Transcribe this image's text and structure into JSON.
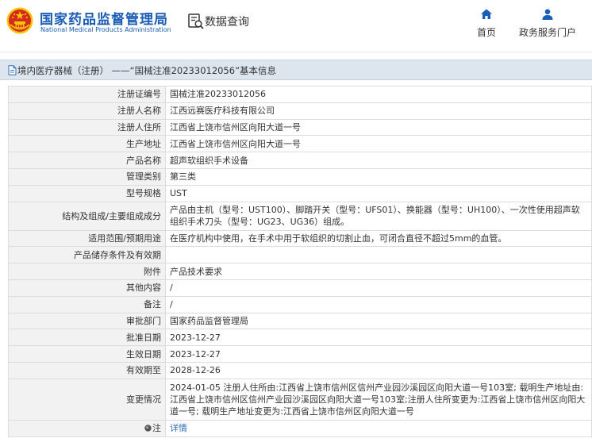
{
  "header": {
    "agency_cn": "国家药品监督管理局",
    "agency_en": "National Medical Products Administration",
    "query_label": "数据查询",
    "nav": [
      {
        "label": "首页",
        "icon": "home-icon"
      },
      {
        "label": "政务服务门户",
        "icon": "user-icon"
      }
    ]
  },
  "title_bar": {
    "text": "境内医疗器械（注册） ——“国械注准20233012056”基本信息",
    "icon": "document-icon"
  },
  "details": [
    {
      "label": "注册证编号",
      "value": "国械注准20233012056"
    },
    {
      "label": "注册人名称",
      "value": "江西远赛医疗科技有限公司"
    },
    {
      "label": "注册人住所",
      "value": "江西省上饶市信州区向阳大道一号"
    },
    {
      "label": "生产地址",
      "value": "江西省上饶市信州区向阳大道一号"
    },
    {
      "label": "产品名称",
      "value": "超声软组织手术设备"
    },
    {
      "label": "管理类别",
      "value": "第三类"
    },
    {
      "label": "型号规格",
      "value": "UST"
    },
    {
      "label": "结构及组成/主要组成成分",
      "value": "产品由主机（型号：UST100）、脚踏开关（型号：UFS01）、换能器（型号：UH100）、一次性使用超声软组织手术刀头（型号：UG23、UG36）组成。"
    },
    {
      "label": "适用范围/预期用途",
      "value": "在医疗机构中使用，在手术中用于软组织的切割止血，可闭合直径不超过5mm的血管。"
    },
    {
      "label": "产品储存条件及有效期",
      "value": ""
    },
    {
      "label": "附件",
      "value": "产品技术要求"
    },
    {
      "label": "其他内容",
      "value": "/"
    },
    {
      "label": "备注",
      "value": "/"
    },
    {
      "label": "审批部门",
      "value": "国家药品监督管理局"
    },
    {
      "label": "批准日期",
      "value": "2023-12-27"
    },
    {
      "label": "生效日期",
      "value": "2023-12-27"
    },
    {
      "label": "有效期至",
      "value": "2028-12-26"
    },
    {
      "label": "变更情况",
      "value": "2024-01-05 注册人住所由:江西省上饶市信州区信州产业园沙溪园区向阳大道一号103室; 载明生产地址由:江西省上饶市信州区信州产业园沙溪园区向阳大道一号103室;注册人住所变更为:江西省上饶市信州区向阳大道一号; 载明生产地址变更为:江西省上饶市信州区向阳大道一号"
    },
    {
      "label": "注",
      "value": "详情",
      "icon": "note-icon"
    }
  ],
  "colors": {
    "brand_blue": "#1a5db5",
    "link_blue": "#2e6fb8",
    "title_bar_bg": "#dde6ef",
    "label_bg": "#f2f2f2",
    "emblem_red": "#d52b1e",
    "emblem_gold": "#f5c400"
  }
}
